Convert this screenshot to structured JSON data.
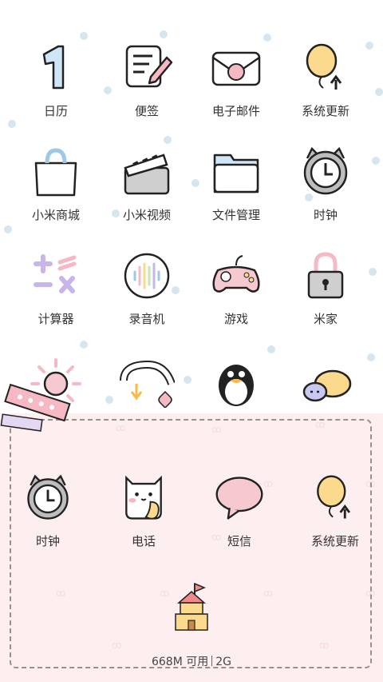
{
  "apps": [
    {
      "label": "日历",
      "icon": "calendar-icon"
    },
    {
      "label": "便签",
      "icon": "notes-icon"
    },
    {
      "label": "电子邮件",
      "icon": "email-icon"
    },
    {
      "label": "系统更新",
      "icon": "update-balloon-icon"
    },
    {
      "label": "小米商城",
      "icon": "shopping-bag-icon"
    },
    {
      "label": "小米视频",
      "icon": "clapperboard-icon"
    },
    {
      "label": "文件管理",
      "icon": "folder-icon"
    },
    {
      "label": "时钟",
      "icon": "clock-icon"
    },
    {
      "label": "计算器",
      "icon": "calculator-icon"
    },
    {
      "label": "录音机",
      "icon": "recorder-icon"
    },
    {
      "label": "游戏",
      "icon": "gamepad-icon"
    },
    {
      "label": "米家",
      "icon": "lock-icon"
    }
  ],
  "partial_row": [
    {
      "icon": "sun-icon"
    },
    {
      "icon": "rainbow-download-icon"
    },
    {
      "icon": "penguin-icon"
    },
    {
      "icon": "chat-bubbles-icon"
    }
  ],
  "dock": [
    {
      "label": "时钟",
      "icon": "clock-icon"
    },
    {
      "label": "电话",
      "icon": "phone-cat-icon"
    },
    {
      "label": "短信",
      "icon": "message-bubble-icon"
    },
    {
      "label": "系统更新",
      "icon": "update-balloon-icon"
    }
  ],
  "memory": {
    "available": "668M 可用",
    "network": "2G"
  },
  "colors": {
    "dock_bg": "#fdeef0",
    "dot": "#d5e6ee",
    "accent_pink": "#f6b9c4",
    "accent_yellow": "#fbd98d"
  }
}
